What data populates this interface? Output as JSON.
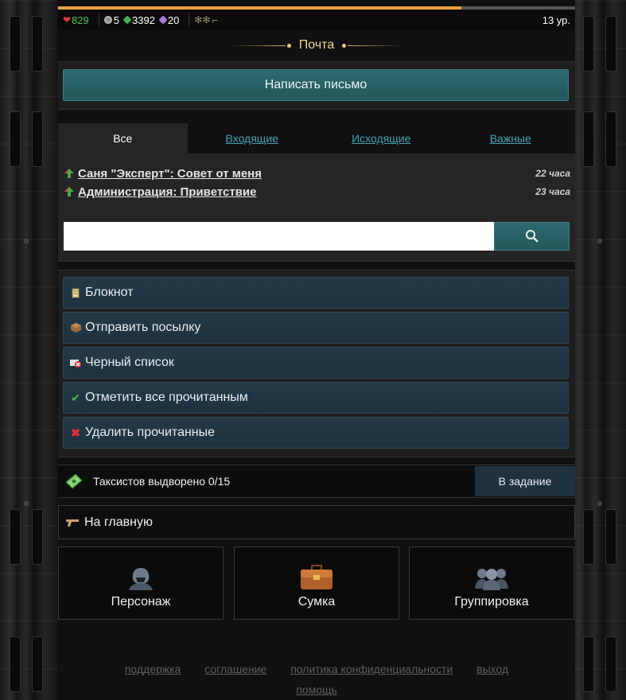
{
  "status": {
    "hp": "829",
    "ammo": "5",
    "money": "3392",
    "gems": "20",
    "level": "13 ур.",
    "xp_progress": 0.78
  },
  "page_title": "Почта",
  "write_button": "Написать письмо",
  "tabs": [
    {
      "label": "Все",
      "active": true
    },
    {
      "label": "Входящие",
      "active": false
    },
    {
      "label": "Исходящие",
      "active": false
    },
    {
      "label": "Важные",
      "active": false
    }
  ],
  "messages": [
    {
      "subject": "Саня \"Эксперт\": Совет от меня",
      "time": "22 часа"
    },
    {
      "subject": "Администрация: Приветствие",
      "time": "23 часа"
    }
  ],
  "search": {
    "value": "",
    "icon": "search-icon"
  },
  "menu": [
    {
      "label": "Блокнот",
      "icon": "notepad-icon"
    },
    {
      "label": "Отправить посылку",
      "icon": "parcel-icon"
    },
    {
      "label": "Черный список",
      "icon": "blacklist-icon"
    },
    {
      "label": "Отметить все прочитанным",
      "icon": "checkmark-icon"
    },
    {
      "label": "Удалить прочитанные",
      "icon": "delete-icon"
    }
  ],
  "task": {
    "text": "Таксистов выдворено 0/15",
    "button": "В задание"
  },
  "home_link": "На главную",
  "cards": [
    {
      "label": "Персонаж",
      "icon": "character-icon"
    },
    {
      "label": "Сумка",
      "icon": "bag-icon"
    },
    {
      "label": "Группировка",
      "icon": "group-icon"
    }
  ],
  "footer": {
    "links": [
      "поддержка",
      "соглашение",
      "политика конфиденциальности",
      "выход"
    ],
    "help": "помощь"
  },
  "colors": {
    "accent_teal": "#2e6a6e",
    "menu_blue": "#243a48",
    "title_gold": "#f0d890",
    "link_teal": "#45a2b6"
  }
}
